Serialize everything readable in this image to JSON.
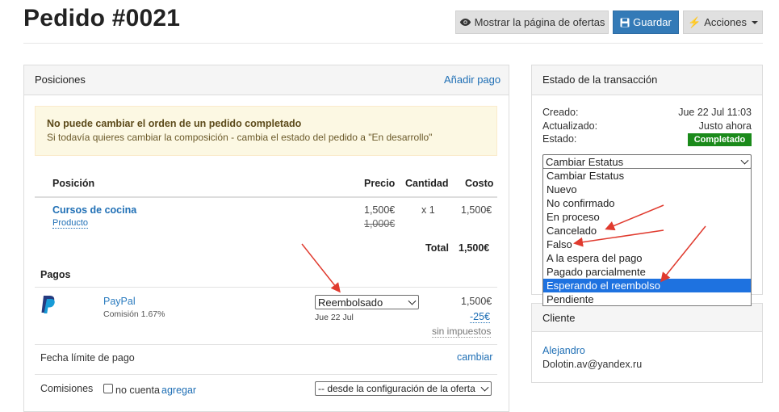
{
  "page": {
    "title": "Pedido #0021"
  },
  "toolbar": {
    "show_offers_label": "Mostrar la página de ofertas",
    "save_label": "Guardar",
    "actions_label": "Acciones"
  },
  "positions_panel": {
    "title": "Posiciones",
    "add_payment_link": "Añadir pago",
    "alert": {
      "title": "No puede cambiar el orden de un pedido completado",
      "body": "Si todavía quieres cambiar la composición - cambia el estado del pedido a \"En desarrollo\""
    },
    "table": {
      "headers": {
        "position": "Posición",
        "price": "Precio",
        "quantity": "Cantidad",
        "cost": "Costo"
      },
      "rows": [
        {
          "name": "Cursos de cocina",
          "type": "Producto",
          "price": "1,500€",
          "old_price": "1,000€",
          "quantity": "x 1",
          "cost": "1,500€"
        }
      ],
      "total_label": "Total",
      "total_value": "1,500€"
    },
    "payments": {
      "title": "Pagos",
      "items": [
        {
          "method": "PayPal",
          "commission": "Comisión 1.67%",
          "status": "Reembolsado",
          "date": "Jue 22 Jul",
          "amount": "1,500€",
          "fee": "-25€",
          "tax_note": "sin impuestos"
        }
      ]
    },
    "due_date": {
      "label": "Fecha límite de pago",
      "action": "cambiar"
    },
    "commissions": {
      "label": "Comisiones",
      "checkbox_label": "no cuenta",
      "add_link": "agregar",
      "select_value": "-- desde la configuración de la oferta"
    }
  },
  "transaction_panel": {
    "title": "Estado de la transacción",
    "created_label": "Creado:",
    "created_value": "Jue 22 Jul 11:03",
    "updated_label": "Actualizado:",
    "updated_value": "Justo ahora",
    "status_label": "Estado:",
    "status_value": "Completado",
    "status_color": "#1a8a1a",
    "select_value": "Cambiar Estatus",
    "options": [
      "Cambiar Estatus",
      "Nuevo",
      "No confirmado",
      "En proceso",
      "Cancelado",
      "Falso",
      "A la espera del pago",
      "Pagado parcialmente",
      "Esperando el reembolso",
      "Pendiente"
    ],
    "selected_option": "Esperando el reembolso"
  },
  "client_panel": {
    "title": "Cliente",
    "name": "Alejandro",
    "email": "Dolotin.av@yandex.ru"
  },
  "colors": {
    "accent": "#337ab7",
    "link": "#1f6fb5",
    "annotation_arrow": "#e03a2e",
    "alert_bg": "#fcf8e3",
    "highlight": "#1e72e0"
  }
}
